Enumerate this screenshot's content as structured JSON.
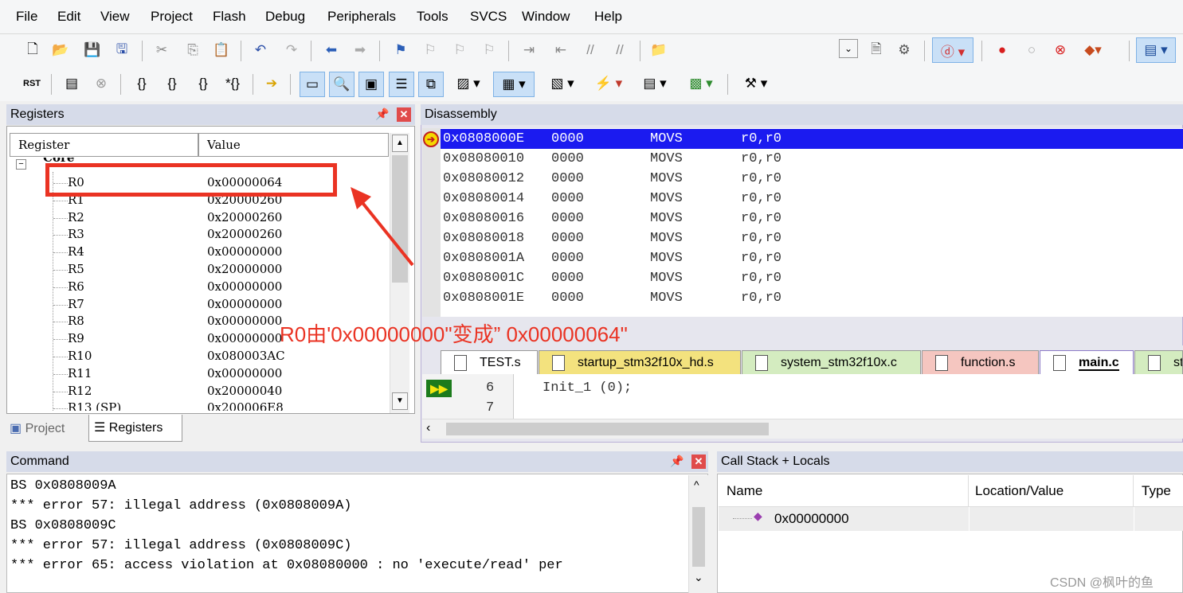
{
  "menu": [
    "File",
    "Edit",
    "View",
    "Project",
    "Flash",
    "Debug",
    "Peripherals",
    "Tools",
    "SVCS",
    "Window",
    "Help"
  ],
  "registers": {
    "title": "Registers",
    "col_register": "Register",
    "col_value": "Value",
    "group": "Core",
    "rows": [
      {
        "name": "R0",
        "value": "0x00000064"
      },
      {
        "name": "R1",
        "value": "0x20000260"
      },
      {
        "name": "R2",
        "value": "0x20000260"
      },
      {
        "name": "R3",
        "value": "0x20000260"
      },
      {
        "name": "R4",
        "value": "0x00000000"
      },
      {
        "name": "R5",
        "value": "0x20000000"
      },
      {
        "name": "R6",
        "value": "0x00000000"
      },
      {
        "name": "R7",
        "value": "0x00000000"
      },
      {
        "name": "R8",
        "value": "0x00000000"
      },
      {
        "name": "R9",
        "value": "0x00000000"
      },
      {
        "name": "R10",
        "value": "0x080003AC"
      },
      {
        "name": "R11",
        "value": "0x00000000"
      },
      {
        "name": "R12",
        "value": "0x20000040"
      },
      {
        "name": "R13 (SP)",
        "value": "0x200006E8"
      }
    ],
    "bottom_tabs": [
      "Project",
      "Registers"
    ]
  },
  "disassembly": {
    "title": "Disassembly",
    "lines": [
      {
        "addr": "0x0808000E",
        "op": "0000",
        "mn": "MOVS",
        "args": "r0,r0",
        "current": true
      },
      {
        "addr": "0x08080010",
        "op": "0000",
        "mn": "MOVS",
        "args": "r0,r0"
      },
      {
        "addr": "0x08080012",
        "op": "0000",
        "mn": "MOVS",
        "args": "r0,r0"
      },
      {
        "addr": "0x08080014",
        "op": "0000",
        "mn": "MOVS",
        "args": "r0,r0"
      },
      {
        "addr": "0x08080016",
        "op": "0000",
        "mn": "MOVS",
        "args": "r0,r0"
      },
      {
        "addr": "0x08080018",
        "op": "0000",
        "mn": "MOVS",
        "args": "r0,r0"
      },
      {
        "addr": "0x0808001A",
        "op": "0000",
        "mn": "MOVS",
        "args": "r0,r0"
      },
      {
        "addr": "0x0808001C",
        "op": "0000",
        "mn": "MOVS",
        "args": "r0,r0"
      },
      {
        "addr": "0x0808001E",
        "op": "0000",
        "mn": "MOVS",
        "args": "r0,r0"
      }
    ]
  },
  "annotation": "R0由'0x00000000\"变成” 0x00000064\"",
  "file_tabs": [
    {
      "label": "TEST.s",
      "color": "#ffffff"
    },
    {
      "label": "startup_stm32f10x_hd.s",
      "color": "#f3e27e"
    },
    {
      "label": "system_stm32f10x.c",
      "color": "#d4ecc0"
    },
    {
      "label": "function.s",
      "color": "#f5c6c0"
    },
    {
      "label": "main.c",
      "color": "#ffffff",
      "active": true
    },
    {
      "label": "st",
      "color": "#d4ecc0"
    }
  ],
  "editor": {
    "lines": [
      {
        "num": "6",
        "code": "Init_1 (0);"
      },
      {
        "num": "7",
        "code": ""
      }
    ]
  },
  "command": {
    "title": "Command",
    "lines": [
      "BS 0x0808009A",
      "*** error 57: illegal address (0x0808009A)",
      "BS 0x0808009C",
      "*** error 57: illegal address (0x0808009C)",
      "*** error 65: access violation at 0x08080000 : no 'execute/read' per"
    ]
  },
  "callstack": {
    "title": "Call Stack + Locals",
    "col_name": "Name",
    "col_location": "Location/Value",
    "col_type": "Type",
    "row_name": "0x00000000"
  },
  "watermark": "CSDN @枫叶的鱼",
  "colors": {
    "highlight": "#1b1bf0",
    "annotation": "#ea3323",
    "panel_header": "#d6dbe9"
  }
}
